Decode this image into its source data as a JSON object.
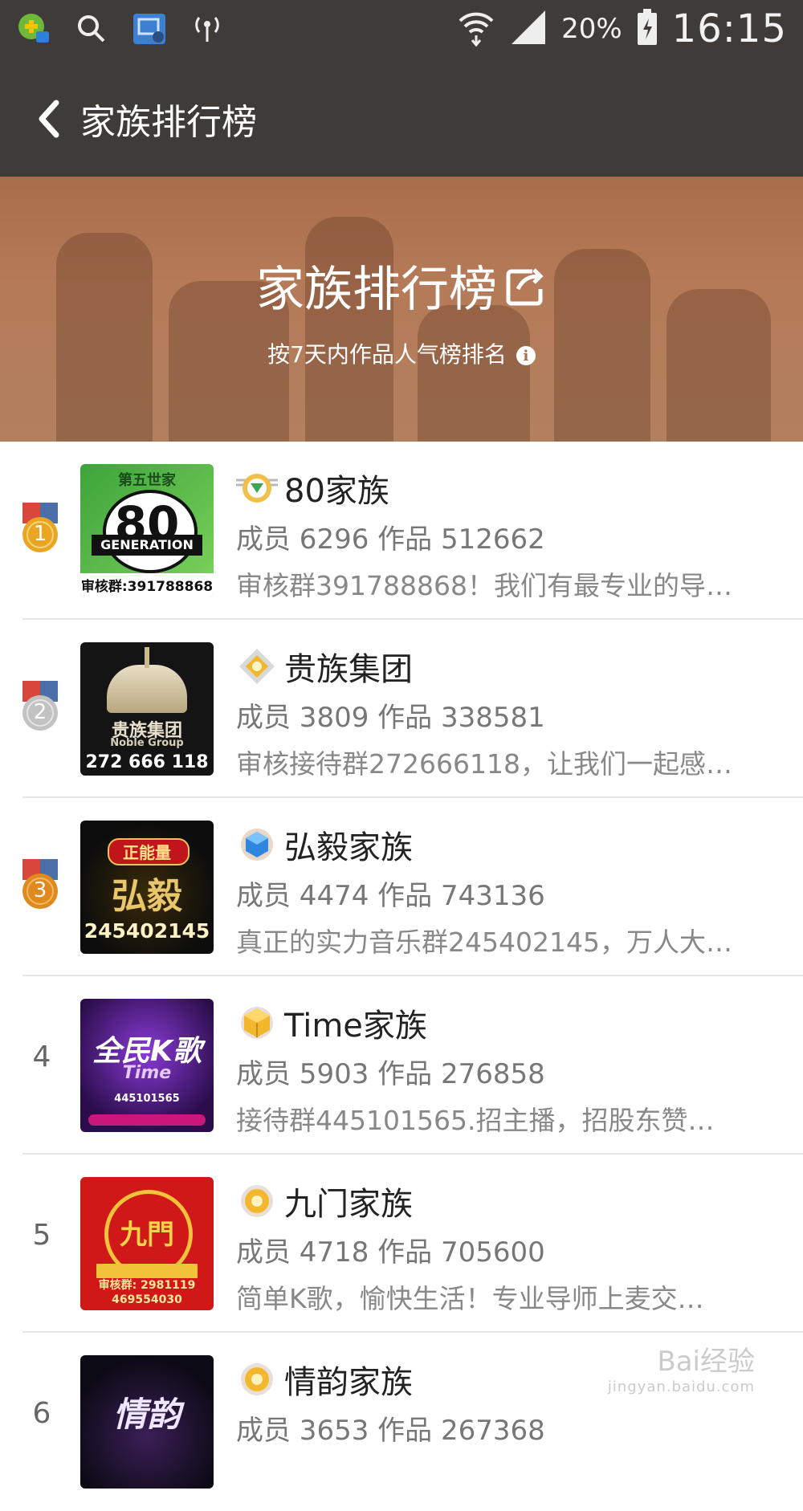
{
  "status_bar": {
    "battery": "20%",
    "time": "16:15",
    "left_icons": [
      "app-notification-icon",
      "search-icon",
      "screen-cast-icon",
      "hotspot-icon"
    ],
    "right_icons": [
      "wifi-icon",
      "signal-icon",
      "battery-icon"
    ]
  },
  "app_bar": {
    "title": "家族排行榜"
  },
  "banner": {
    "title": "家族排行榜",
    "subtitle": "按7天内作品人气榜排名"
  },
  "families": [
    {
      "rank": "1",
      "medal": "gold",
      "name": "80家族",
      "stats": "成员 6296 作品 512662",
      "desc": "审核群391788868！我们有最专业的导…",
      "avatar_text_top": "第五世家",
      "avatar_text_mid": "80",
      "avatar_text_sub": "GENERATION",
      "avatar_text_bottom": "审核群:391788868",
      "avatar_bg": "#2f8a2f",
      "badge": "green-wing-badge"
    },
    {
      "rank": "2",
      "medal": "silver",
      "name": "贵族集团",
      "stats": "成员 3809 作品 338581",
      "desc": "审核接待群272666118，让我们一起感…",
      "avatar_text_top": "",
      "avatar_text_mid": "贵族集团",
      "avatar_text_sub": "Noble Group",
      "avatar_text_bottom": "272 666 118",
      "avatar_bg": "#141414",
      "badge": "gold-diamond-badge"
    },
    {
      "rank": "3",
      "medal": "bronze",
      "name": "弘毅家族",
      "stats": "成员 4474 作品 743136",
      "desc": "真正的实力音乐群245402145，万人大…",
      "avatar_text_top": "正能量",
      "avatar_text_mid": "弘毅",
      "avatar_text_sub": "",
      "avatar_text_bottom": "245402145",
      "avatar_bg": "#111111",
      "badge": "blue-gem-badge"
    },
    {
      "rank": "4",
      "medal": "",
      "name": "Time家族",
      "stats": "成员 5903 作品 276858",
      "desc": "接待群445101565.招主播，招股东赞…",
      "avatar_text_top": "",
      "avatar_text_mid": "全民K歌",
      "avatar_text_sub": "Time",
      "avatar_text_bottom": "445101565",
      "avatar_bg": "#3a1660",
      "badge": "gold-cube-badge"
    },
    {
      "rank": "5",
      "medal": "",
      "name": "九门家族",
      "stats": "成员 4718 作品 705600",
      "desc": "简单K歌，愉快生活！专业导师上麦交…",
      "avatar_text_top": "",
      "avatar_text_mid": "九門",
      "avatar_text_sub": "",
      "avatar_text_bottom": "审核群: 2981119 469554030",
      "avatar_bg": "#d01818",
      "badge": "gold-ring-badge"
    },
    {
      "rank": "6",
      "medal": "",
      "name": "情韵家族",
      "stats": "成员 3653 作品 267368",
      "desc": "",
      "avatar_text_top": "",
      "avatar_text_mid": "情韵",
      "avatar_text_sub": "",
      "avatar_text_bottom": "",
      "avatar_bg": "#14101c",
      "badge": "gold-ring-badge"
    }
  ],
  "watermark": {
    "brand": "Bai经验",
    "url": "jingyan.baidu.com"
  },
  "colors": {
    "header_bg": "#3f3b39",
    "banner_bg": "#b07553",
    "gold": "#e8a623",
    "silver": "#b9b9b9",
    "bronze": "#e08a1e",
    "ribbon_red": "#d8473c",
    "ribbon_blue": "#4b6fa8"
  }
}
